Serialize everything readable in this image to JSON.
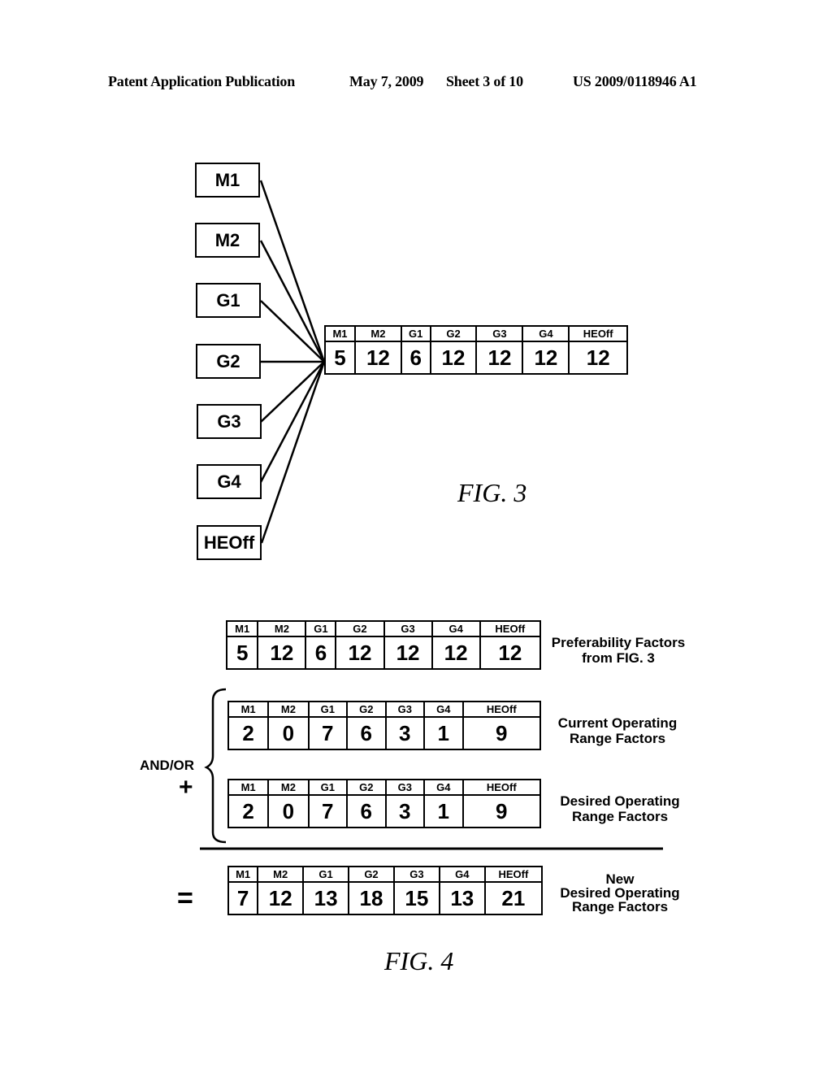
{
  "header": {
    "publication": "Patent Application Publication",
    "date": "May 7, 2009",
    "sheet": "Sheet 3 of 10",
    "number": "US 2009/0118946 A1"
  },
  "fig3": {
    "nodes": [
      "M1",
      "M2",
      "G1",
      "G2",
      "G3",
      "G4",
      "HEOff"
    ],
    "table": {
      "headers": [
        "M1",
        "M2",
        "G1",
        "G2",
        "G3",
        "G4",
        "HEOff"
      ],
      "values": [
        "5",
        "12",
        "6",
        "12",
        "12",
        "12",
        "12"
      ]
    },
    "caption": "FIG. 3"
  },
  "fig4": {
    "preferability": {
      "headers": [
        "M1",
        "M2",
        "G1",
        "G2",
        "G3",
        "G4",
        "HEOff"
      ],
      "values": [
        "5",
        "12",
        "6",
        "12",
        "12",
        "12",
        "12"
      ],
      "label_line1": "Preferability Factors",
      "label_line2": "from FIG. 3"
    },
    "current": {
      "headers": [
        "M1",
        "M2",
        "G1",
        "G2",
        "G3",
        "G4",
        "HEOff"
      ],
      "values": [
        "2",
        "0",
        "7",
        "6",
        "3",
        "1",
        "9"
      ],
      "label_line1": "Current Operating",
      "label_line2": "Range Factors"
    },
    "desired": {
      "headers": [
        "M1",
        "M2",
        "G1",
        "G2",
        "G3",
        "G4",
        "HEOff"
      ],
      "values": [
        "2",
        "0",
        "7",
        "6",
        "3",
        "1",
        "9"
      ],
      "label_line1": "Desired Operating",
      "label_line2": "Range Factors"
    },
    "result": {
      "headers": [
        "M1",
        "M2",
        "G1",
        "G2",
        "G3",
        "G4",
        "HEOff"
      ],
      "values": [
        "7",
        "12",
        "13",
        "18",
        "15",
        "13",
        "21"
      ],
      "label_line1": "New",
      "label_line2": "Desired Operating",
      "label_line3": "Range Factors"
    },
    "and_or_label": "AND/OR",
    "plus_sign": "+",
    "equals_sign": "=",
    "caption": "FIG. 4"
  }
}
